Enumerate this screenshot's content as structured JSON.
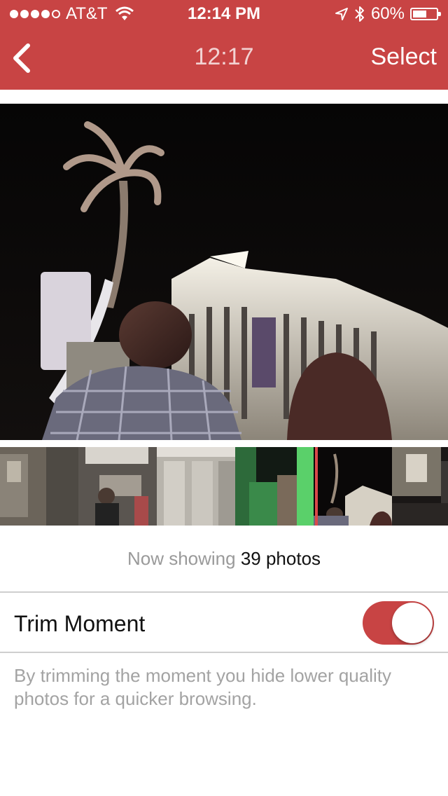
{
  "status_bar": {
    "carrier": "AT&T",
    "time": "12:14 PM",
    "battery": "60%",
    "battery_level": 0.6,
    "signal_bars": 4,
    "icons": [
      "wifi-icon",
      "location-icon",
      "bluetooth-icon",
      "battery-icon"
    ]
  },
  "nav": {
    "title": "12:17",
    "select_label": "Select",
    "back_icon": "chevron-left-icon"
  },
  "filmstrip": {
    "thumbnail_count": 6,
    "current_index": 4
  },
  "summary": {
    "prefix": "Now showing",
    "count_text": "39 photos"
  },
  "trim": {
    "label": "Trim Moment",
    "enabled": true,
    "description": "By trimming the moment you hide lower quality photos for a quicker browsing."
  },
  "colors": {
    "accent": "#c84444",
    "divider": "#cfcfcf",
    "muted_text": "#9a9a9a"
  }
}
